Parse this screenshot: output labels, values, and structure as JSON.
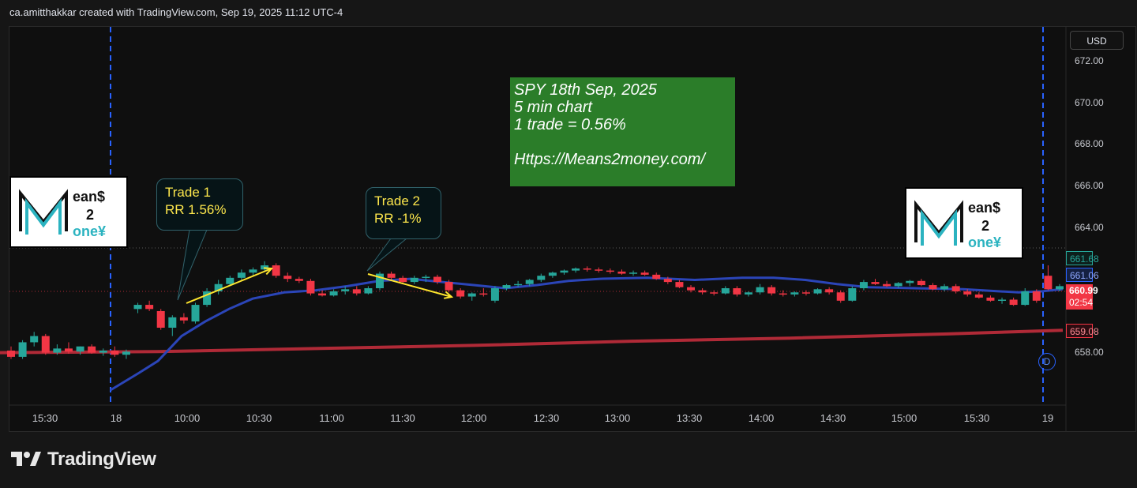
{
  "header": {
    "text": "ca.amitthakkar created with TradingView.com, Sep 19, 2025 11:12 UTC-4"
  },
  "currency": "USD",
  "footer": {
    "brand": "TradingView"
  },
  "chart_data": {
    "type": "candlestick",
    "title": "",
    "y_ticks": [
      "672.00",
      "670.00",
      "668.00",
      "666.00",
      "664.00",
      "658.00"
    ],
    "x_ticks": [
      "15:30",
      "18",
      "10:00",
      "10:30",
      "11:00",
      "11:30",
      "12:00",
      "12:30",
      "13:00",
      "13:30",
      "14:00",
      "14:30",
      "15:00",
      "15:30",
      "19"
    ],
    "ylim": [
      657,
      673
    ],
    "price_labels": {
      "high": "661.68",
      "ma_fast": "661.06",
      "last": "660.99",
      "countdown": "02:54",
      "ma_slow": "659.08"
    },
    "colors": {
      "up": "#26a69a",
      "down": "#f23645",
      "ma_fast": "#2b45b8",
      "ma_slow": "#b02a37",
      "session": "#2962ff"
    },
    "annotations": {
      "trade1": [
        "Trade 1",
        "RR 1.56%"
      ],
      "trade2": [
        "Trade 2",
        "RR -1%"
      ],
      "note": [
        "SPY 18th Sep, 2025",
        "5 min chart",
        "1 trade = 0.56%",
        "",
        "Https://Means2money.com/"
      ],
      "logo_left": {
        "top": "ean$",
        "mid": "2",
        "bot": "one¥"
      },
      "logo_right": {
        "top": "ean$",
        "mid": "2",
        "bot": "one¥"
      },
      "day_badge": "D"
    },
    "candles": [
      {
        "o": 658.1,
        "h": 658.3,
        "l": 657.7,
        "c": 657.8
      },
      {
        "o": 657.8,
        "h": 658.6,
        "l": 657.7,
        "c": 658.5
      },
      {
        "o": 658.5,
        "h": 659.0,
        "l": 658.3,
        "c": 658.8
      },
      {
        "o": 658.8,
        "h": 658.9,
        "l": 657.9,
        "c": 658.0
      },
      {
        "o": 658.0,
        "h": 658.4,
        "l": 657.9,
        "c": 658.2
      },
      {
        "o": 658.2,
        "h": 658.5,
        "l": 657.95,
        "c": 658.05
      },
      {
        "o": 658.05,
        "h": 658.3,
        "l": 657.9,
        "c": 658.3
      },
      {
        "o": 658.3,
        "h": 658.4,
        "l": 657.95,
        "c": 658.0
      },
      {
        "o": 658.0,
        "h": 658.2,
        "l": 657.85,
        "c": 658.1
      },
      {
        "o": 658.1,
        "h": 658.3,
        "l": 657.8,
        "c": 657.9
      },
      {
        "o": 657.9,
        "h": 658.15,
        "l": 657.7,
        "c": 658.05
      },
      {
        "o": 660.1,
        "h": 660.4,
        "l": 659.9,
        "c": 660.3
      },
      {
        "o": 660.3,
        "h": 660.5,
        "l": 660.0,
        "c": 660.1
      },
      {
        "o": 660.0,
        "h": 660.1,
        "l": 659.1,
        "c": 659.2
      },
      {
        "o": 659.2,
        "h": 659.8,
        "l": 658.8,
        "c": 659.7
      },
      {
        "o": 659.7,
        "h": 659.9,
        "l": 659.4,
        "c": 659.55
      },
      {
        "o": 659.5,
        "h": 660.4,
        "l": 659.4,
        "c": 660.3
      },
      {
        "o": 660.3,
        "h": 661.1,
        "l": 660.2,
        "c": 660.95
      },
      {
        "o": 660.95,
        "h": 661.5,
        "l": 660.8,
        "c": 661.3
      },
      {
        "o": 661.3,
        "h": 661.7,
        "l": 661.2,
        "c": 661.6
      },
      {
        "o": 661.6,
        "h": 662.0,
        "l": 661.5,
        "c": 661.85
      },
      {
        "o": 661.85,
        "h": 662.1,
        "l": 661.7,
        "c": 662.0
      },
      {
        "o": 662.0,
        "h": 662.4,
        "l": 661.9,
        "c": 662.2
      },
      {
        "o": 662.2,
        "h": 662.3,
        "l": 661.6,
        "c": 661.7
      },
      {
        "o": 661.7,
        "h": 661.85,
        "l": 661.4,
        "c": 661.55
      },
      {
        "o": 661.55,
        "h": 661.65,
        "l": 661.35,
        "c": 661.45
      },
      {
        "o": 661.45,
        "h": 661.55,
        "l": 660.75,
        "c": 660.85
      },
      {
        "o": 660.85,
        "h": 661.0,
        "l": 660.7,
        "c": 660.75
      },
      {
        "o": 660.75,
        "h": 661.05,
        "l": 660.7,
        "c": 660.95
      },
      {
        "o": 660.95,
        "h": 661.2,
        "l": 660.8,
        "c": 661.05
      },
      {
        "o": 661.05,
        "h": 661.2,
        "l": 660.75,
        "c": 660.85
      },
      {
        "o": 660.85,
        "h": 661.2,
        "l": 660.8,
        "c": 661.1
      },
      {
        "o": 661.1,
        "h": 661.9,
        "l": 661.0,
        "c": 661.8
      },
      {
        "o": 661.8,
        "h": 661.9,
        "l": 661.5,
        "c": 661.6
      },
      {
        "o": 661.6,
        "h": 661.7,
        "l": 661.3,
        "c": 661.4
      },
      {
        "o": 661.4,
        "h": 661.7,
        "l": 661.3,
        "c": 661.6
      },
      {
        "o": 661.6,
        "h": 661.75,
        "l": 661.4,
        "c": 661.65
      },
      {
        "o": 661.65,
        "h": 661.75,
        "l": 661.3,
        "c": 661.4
      },
      {
        "o": 661.4,
        "h": 661.5,
        "l": 660.9,
        "c": 661.0
      },
      {
        "o": 661.0,
        "h": 661.1,
        "l": 660.6,
        "c": 660.7
      },
      {
        "o": 660.7,
        "h": 660.9,
        "l": 660.5,
        "c": 660.85
      },
      {
        "o": 660.85,
        "h": 661.1,
        "l": 660.7,
        "c": 660.8
      },
      {
        "o": 660.5,
        "h": 661.2,
        "l": 660.4,
        "c": 661.1
      },
      {
        "o": 661.1,
        "h": 661.3,
        "l": 661.0,
        "c": 661.25
      },
      {
        "o": 661.25,
        "h": 661.45,
        "l": 661.15,
        "c": 661.3
      },
      {
        "o": 661.3,
        "h": 661.55,
        "l": 661.2,
        "c": 661.5
      },
      {
        "o": 661.5,
        "h": 661.8,
        "l": 661.4,
        "c": 661.7
      },
      {
        "o": 661.7,
        "h": 661.9,
        "l": 661.6,
        "c": 661.85
      },
      {
        "o": 661.85,
        "h": 662.0,
        "l": 661.75,
        "c": 661.95
      },
      {
        "o": 661.95,
        "h": 662.1,
        "l": 661.85,
        "c": 662.05
      },
      {
        "o": 662.05,
        "h": 662.15,
        "l": 661.9,
        "c": 662.0
      },
      {
        "o": 662.0,
        "h": 662.1,
        "l": 661.85,
        "c": 661.95
      },
      {
        "o": 661.95,
        "h": 662.05,
        "l": 661.8,
        "c": 661.9
      },
      {
        "o": 661.9,
        "h": 662.0,
        "l": 661.75,
        "c": 661.8
      },
      {
        "o": 661.8,
        "h": 661.95,
        "l": 661.7,
        "c": 661.85
      },
      {
        "o": 661.85,
        "h": 661.95,
        "l": 661.7,
        "c": 661.75
      },
      {
        "o": 661.75,
        "h": 661.85,
        "l": 661.5,
        "c": 661.55
      },
      {
        "o": 661.55,
        "h": 661.65,
        "l": 661.3,
        "c": 661.4
      },
      {
        "o": 661.4,
        "h": 661.5,
        "l": 661.1,
        "c": 661.15
      },
      {
        "o": 661.15,
        "h": 661.25,
        "l": 660.9,
        "c": 661.0
      },
      {
        "o": 661.0,
        "h": 661.1,
        "l": 660.8,
        "c": 660.9
      },
      {
        "o": 660.9,
        "h": 661.0,
        "l": 660.75,
        "c": 660.85
      },
      {
        "o": 660.85,
        "h": 661.2,
        "l": 660.8,
        "c": 661.1
      },
      {
        "o": 661.1,
        "h": 661.2,
        "l": 660.7,
        "c": 660.8
      },
      {
        "o": 660.8,
        "h": 660.95,
        "l": 660.7,
        "c": 660.9
      },
      {
        "o": 660.9,
        "h": 661.3,
        "l": 660.8,
        "c": 661.15
      },
      {
        "o": 661.15,
        "h": 661.25,
        "l": 660.75,
        "c": 660.85
      },
      {
        "o": 660.85,
        "h": 661.0,
        "l": 660.7,
        "c": 660.8
      },
      {
        "o": 660.8,
        "h": 660.95,
        "l": 660.7,
        "c": 660.9
      },
      {
        "o": 660.9,
        "h": 661.0,
        "l": 660.75,
        "c": 660.85
      },
      {
        "o": 660.85,
        "h": 661.1,
        "l": 660.8,
        "c": 661.05
      },
      {
        "o": 661.05,
        "h": 661.15,
        "l": 660.8,
        "c": 660.9
      },
      {
        "o": 660.9,
        "h": 661.0,
        "l": 660.4,
        "c": 660.5
      },
      {
        "o": 660.5,
        "h": 661.2,
        "l": 660.45,
        "c": 661.1
      },
      {
        "o": 661.1,
        "h": 661.5,
        "l": 661.0,
        "c": 661.4
      },
      {
        "o": 661.4,
        "h": 661.55,
        "l": 661.25,
        "c": 661.3
      },
      {
        "o": 661.3,
        "h": 661.45,
        "l": 661.15,
        "c": 661.2
      },
      {
        "o": 661.2,
        "h": 661.4,
        "l": 661.1,
        "c": 661.35
      },
      {
        "o": 661.35,
        "h": 661.5,
        "l": 661.2,
        "c": 661.45
      },
      {
        "o": 661.45,
        "h": 661.55,
        "l": 661.2,
        "c": 661.25
      },
      {
        "o": 661.25,
        "h": 661.35,
        "l": 661.0,
        "c": 661.05
      },
      {
        "o": 661.05,
        "h": 661.3,
        "l": 660.95,
        "c": 661.2
      },
      {
        "o": 661.2,
        "h": 661.3,
        "l": 660.85,
        "c": 660.95
      },
      {
        "o": 660.95,
        "h": 661.05,
        "l": 660.7,
        "c": 660.8
      },
      {
        "o": 660.8,
        "h": 660.9,
        "l": 660.6,
        "c": 660.65
      },
      {
        "o": 660.65,
        "h": 660.75,
        "l": 660.45,
        "c": 660.5
      },
      {
        "o": 660.5,
        "h": 660.65,
        "l": 660.35,
        "c": 660.55
      },
      {
        "o": 660.55,
        "h": 660.65,
        "l": 660.25,
        "c": 660.3
      },
      {
        "o": 660.3,
        "h": 661.1,
        "l": 660.25,
        "c": 660.95
      },
      {
        "o": 660.95,
        "h": 661.05,
        "l": 660.4,
        "c": 660.5
      },
      {
        "o": 661.7,
        "h": 662.2,
        "l": 661.0,
        "c": 661.05
      },
      {
        "o": 661.05,
        "h": 661.3,
        "l": 660.95,
        "c": 661.2
      }
    ],
    "ma_fast": [
      [
        140,
        656.2
      ],
      [
        175,
        657.0
      ],
      [
        200,
        657.6
      ],
      [
        230,
        658.8
      ],
      [
        260,
        659.5
      ],
      [
        290,
        660.1
      ],
      [
        320,
        660.6
      ],
      [
        360,
        660.9
      ],
      [
        400,
        661.0
      ],
      [
        440,
        661.2
      ],
      [
        480,
        661.45
      ],
      [
        520,
        661.55
      ],
      [
        560,
        661.4
      ],
      [
        600,
        661.25
      ],
      [
        640,
        661.1
      ],
      [
        680,
        661.25
      ],
      [
        720,
        661.45
      ],
      [
        760,
        661.55
      ],
      [
        820,
        661.6
      ],
      [
        880,
        661.5
      ],
      [
        940,
        661.6
      ],
      [
        980,
        661.6
      ],
      [
        1020,
        661.5
      ],
      [
        1060,
        661.3
      ],
      [
        1100,
        661.15
      ],
      [
        1160,
        661.1
      ],
      [
        1220,
        661.05
      ],
      [
        1290,
        660.9
      ],
      [
        1320,
        660.95
      ],
      [
        1346,
        661.06
      ]
    ],
    "ma_slow": [
      [
        0,
        658.0
      ],
      [
        200,
        658.05
      ],
      [
        400,
        658.2
      ],
      [
        600,
        658.35
      ],
      [
        800,
        658.55
      ],
      [
        1000,
        658.7
      ],
      [
        1200,
        658.9
      ],
      [
        1346,
        659.08
      ]
    ]
  }
}
